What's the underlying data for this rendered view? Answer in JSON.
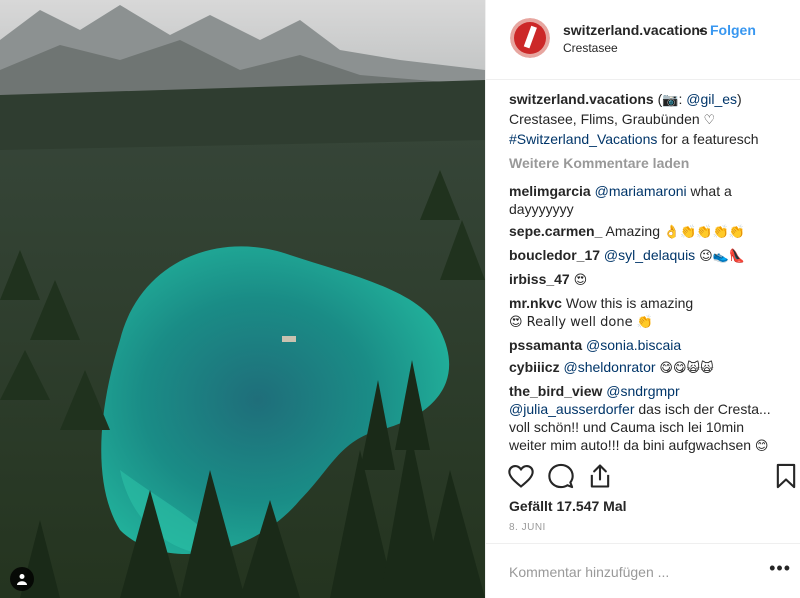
{
  "header": {
    "username": "switzerland.vacations",
    "separator": "•",
    "follow_label": "Folgen",
    "location": "Crestasee"
  },
  "caption": {
    "username": "switzerland.vacations",
    "camera_open": "(",
    "camera_icon": "📷",
    "credit_sep": ": ",
    "credit_mention": "@gil_es",
    "camera_close": ")",
    "text": "Crestasee, Flims, Graubünden",
    "heart_icon": "♡",
    "hashtag": "#Switzerland_Vacations",
    "after_hashtag": " for a featuresch"
  },
  "load_more": "Weitere Kommentare laden",
  "comments": [
    {
      "user": "melimgarcia",
      "mention": "@mariamaroni",
      "text": " what a dayyyyyyy",
      "emoji": ""
    },
    {
      "user": "sepe.carmen_",
      "mention": "",
      "text": " Amazing ",
      "emoji": "👌👏👏👏👏"
    },
    {
      "user": "boucledor_17",
      "mention": "@syl_delaquis",
      "text": " ",
      "emoji": "😉👟👠"
    },
    {
      "user": "irbiss_47",
      "mention": "",
      "text": " ",
      "emoji": "😍"
    },
    {
      "user": "mr.nkvc",
      "mention": "",
      "text": " Wow this is amazing ",
      "emoji": "😍 Really well done 👏"
    },
    {
      "user": "pssamanta",
      "mention": "@sonia.biscaia",
      "text": "",
      "emoji": ""
    },
    {
      "user": "cybiiicz",
      "mention": "@sheldonrator",
      "text": " ",
      "emoji": "😋😋🙀🙀"
    },
    {
      "user": "the_bird_view",
      "mention": "@sndrgmpr",
      "mention2": "@julia_ausserdorfer",
      "text": " das isch der Cresta... voll schön!! und Cauma isch lei 10min weiter mim auto!!! da bini aufgwachsen ",
      "emoji": "😊"
    }
  ],
  "actions": {
    "like_icon": "heart-icon",
    "comment_icon": "comment-icon",
    "share_icon": "share-icon",
    "save_icon": "bookmark-icon"
  },
  "likes": "Gefällt 17.547 Mal",
  "date": "8. JUNI",
  "add_comment": {
    "placeholder": "Kommentar hinzufügen ...",
    "more": "•••"
  },
  "colors": {
    "link": "#3897f0",
    "mention": "#003569",
    "muted": "#999999",
    "text": "#262626",
    "lake": "#1f9e98"
  }
}
